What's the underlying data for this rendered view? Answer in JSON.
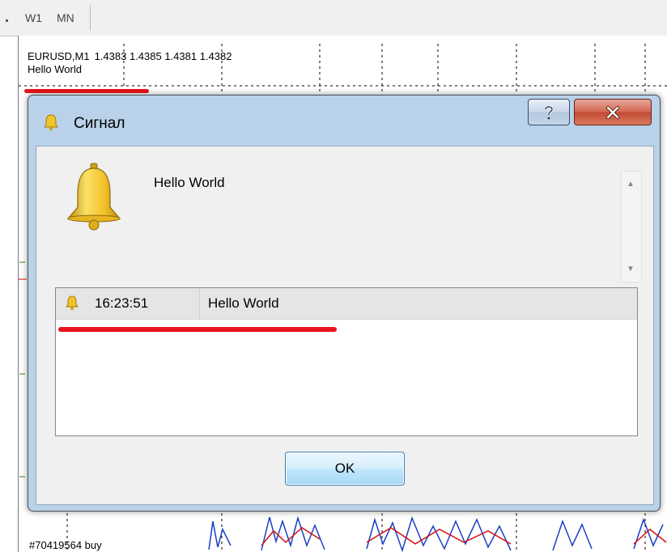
{
  "toolbar": {
    "timeframes": [
      "W1",
      "MN"
    ]
  },
  "chart": {
    "symbol": "EURUSD,M1",
    "ohlc": "1.4383 1.4385 1.4381 1.4382",
    "indicator_label": "Hello World",
    "bottom_text": "#70419564 buy"
  },
  "dialog": {
    "title": "Сигнал",
    "help_icon": "question-icon",
    "close_icon": "close-x-icon",
    "message": "Hello World",
    "alerts": [
      {
        "icon": "bell-icon",
        "time": "16:23:51",
        "message": "Hello World"
      }
    ],
    "ok_label": "OK"
  },
  "colors": {
    "highlight_red": "#e8141c",
    "bell_gold": "#f2c22a",
    "title_blue": "#b9d2ea"
  }
}
